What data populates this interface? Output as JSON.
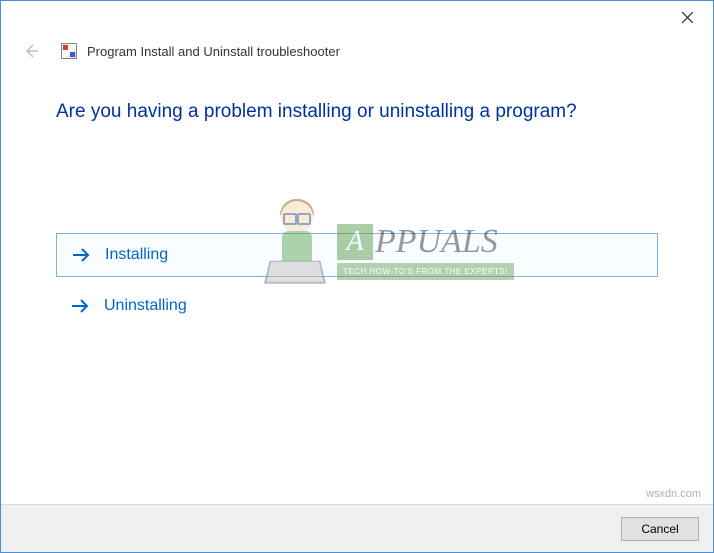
{
  "header": {
    "title": "Program Install and Uninstall troubleshooter"
  },
  "main": {
    "question": "Are you having a problem installing or uninstalling a program?",
    "options": [
      {
        "label": "Installing"
      },
      {
        "label": "Uninstalling"
      }
    ]
  },
  "footer": {
    "cancel_label": "Cancel"
  },
  "watermark": {
    "brand_rest": "PPUALS",
    "tagline": "TECH HOW-TO'S FROM THE EXPERTS!",
    "site": "wsxdn.com"
  }
}
